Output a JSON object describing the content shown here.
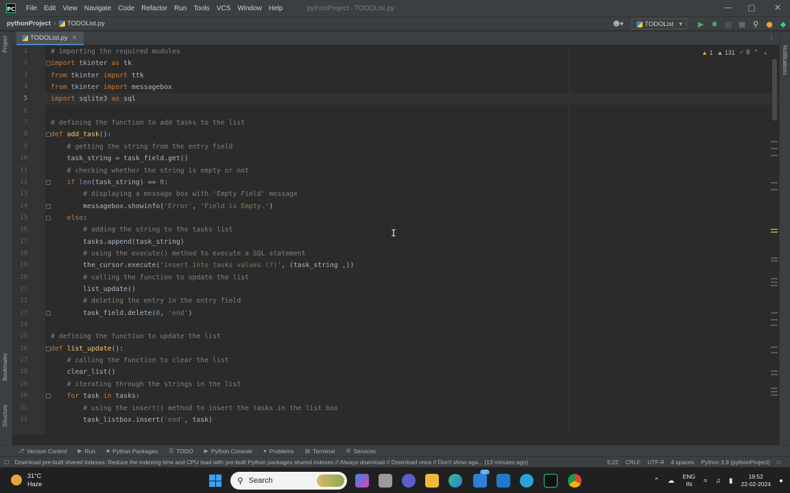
{
  "titlebar": {
    "menu": [
      "File",
      "Edit",
      "View",
      "Navigate",
      "Code",
      "Refactor",
      "Run",
      "Tools",
      "VCS",
      "Window",
      "Help"
    ],
    "window_title": "pythonProject - TODOList.py"
  },
  "navbar": {
    "project": "pythonProject",
    "file": "TODOList.py",
    "run_config": "TODOList"
  },
  "tabs": [
    {
      "label": "TODOList.py"
    }
  ],
  "inspections": {
    "warnings": "1",
    "weak_warnings": "131",
    "typos": "9"
  },
  "editor": {
    "active_line": 5,
    "lines": [
      {
        "n": "1",
        "html": "<span class='cm'># importing the required modules</span>"
      },
      {
        "n": "2",
        "html": "<span class='kw'>import</span> tkinter <span class='kw'>as</span> tk"
      },
      {
        "n": "3",
        "html": "<span class='kw'>from</span> tkinter <span class='kw'>import</span> ttk"
      },
      {
        "n": "4",
        "html": "<span class='kw'>from</span> tkinter <span class='kw'>import</span> messagebox"
      },
      {
        "n": "5",
        "html": "<span class='kw'>import</span> sqlite3 <span class='kw'>as</span> sql"
      },
      {
        "n": "6",
        "html": ""
      },
      {
        "n": "7",
        "html": "<span class='cm'># defining the function to add tasks to the list</span>"
      },
      {
        "n": "8",
        "html": "<span class='kw'>def</span> <span class='fn'>add_task</span>():"
      },
      {
        "n": "9",
        "html": "    <span class='cm'># getting the string from the entry field</span>"
      },
      {
        "n": "10",
        "html": "    task_string = task_field.get()"
      },
      {
        "n": "11",
        "html": "    <span class='cm'># checking whether the string is empty or not</span>"
      },
      {
        "n": "12",
        "html": "    <span class='kw'>if</span> <span class='bi'>len</span>(task_string) == <span class='nm'>0</span>:"
      },
      {
        "n": "13",
        "html": "        <span class='cm'># displaying a message box with 'Empty Field' message</span>"
      },
      {
        "n": "14",
        "html": "        messagebox.showinfo(<span class='st'>'Error'</span>, <span class='st'>'Field is Empty.'</span>)"
      },
      {
        "n": "15",
        "html": "    <span class='kw'>else</span>:"
      },
      {
        "n": "16",
        "html": "        <span class='cm'># adding the string to the tasks list</span>"
      },
      {
        "n": "17",
        "html": "        tasks.append(task_string)"
      },
      {
        "n": "18",
        "html": "        <span class='cm'># using the execute() method to execute a SQL statement</span>"
      },
      {
        "n": "19",
        "html": "        the_cursor.execute(<span class='st'>'insert into tasks values (?)'</span>, (task_string ,))"
      },
      {
        "n": "20",
        "html": "        <span class='cm'># calling the function to update the list</span>"
      },
      {
        "n": "21",
        "html": "        list_update()"
      },
      {
        "n": "22",
        "html": "        <span class='cm'># deleting the entry in the entry field</span>"
      },
      {
        "n": "23",
        "html": "        task_field.delete(<span class='nm'>0</span>, <span class='st'>'end'</span>)"
      },
      {
        "n": "24",
        "html": ""
      },
      {
        "n": "25",
        "html": "<span class='cm'># defining the function to update the list</span>"
      },
      {
        "n": "26",
        "html": "<span class='kw'>def</span> <span class='fn'>list_update</span>():"
      },
      {
        "n": "27",
        "html": "    <span class='cm'># calling the function to clear the list</span>"
      },
      {
        "n": "28",
        "html": "    clear_list()"
      },
      {
        "n": "29",
        "html": "    <span class='cm'># iterating through the strings in the list</span>"
      },
      {
        "n": "30",
        "html": "    <span class='kw'>for</span> task <span class='kw'>in</span> tasks:"
      },
      {
        "n": "31",
        "html": "        <span class='cm'># using the insert() method to insert the tasks in the list box</span>"
      },
      {
        "n": "32",
        "html": "        task_listbox.insert(<span class='st'>'end'</span>, task)"
      }
    ]
  },
  "left_strip": {
    "project": "Project",
    "bookmarks": "Bookmarks",
    "structure": "Structure"
  },
  "right_strip": {
    "notifications": "Notifications"
  },
  "toolwindows": [
    "Version Control",
    "Run",
    "Python Packages",
    "TODO",
    "Python Console",
    "Problems",
    "Terminal",
    "Services"
  ],
  "status": {
    "message": "Download pre-built shared indexes: Reduce the indexing time and CPU load with pre-built Python packages shared indexes // Always download // Download once // Don't show aga... (13 minutes ago)",
    "position": "5:22",
    "line_sep": "CRLF",
    "encoding": "UTF-8",
    "indent": "4 spaces",
    "interpreter": "Python 3.9 (pythonProject)"
  },
  "taskbar": {
    "temp": "31°C",
    "condition": "Haze",
    "search": "Search",
    "lang_top": "ENG",
    "lang_bottom": "IN",
    "time": "19:52",
    "date": "22-02-2024",
    "mail_badge": "17"
  }
}
